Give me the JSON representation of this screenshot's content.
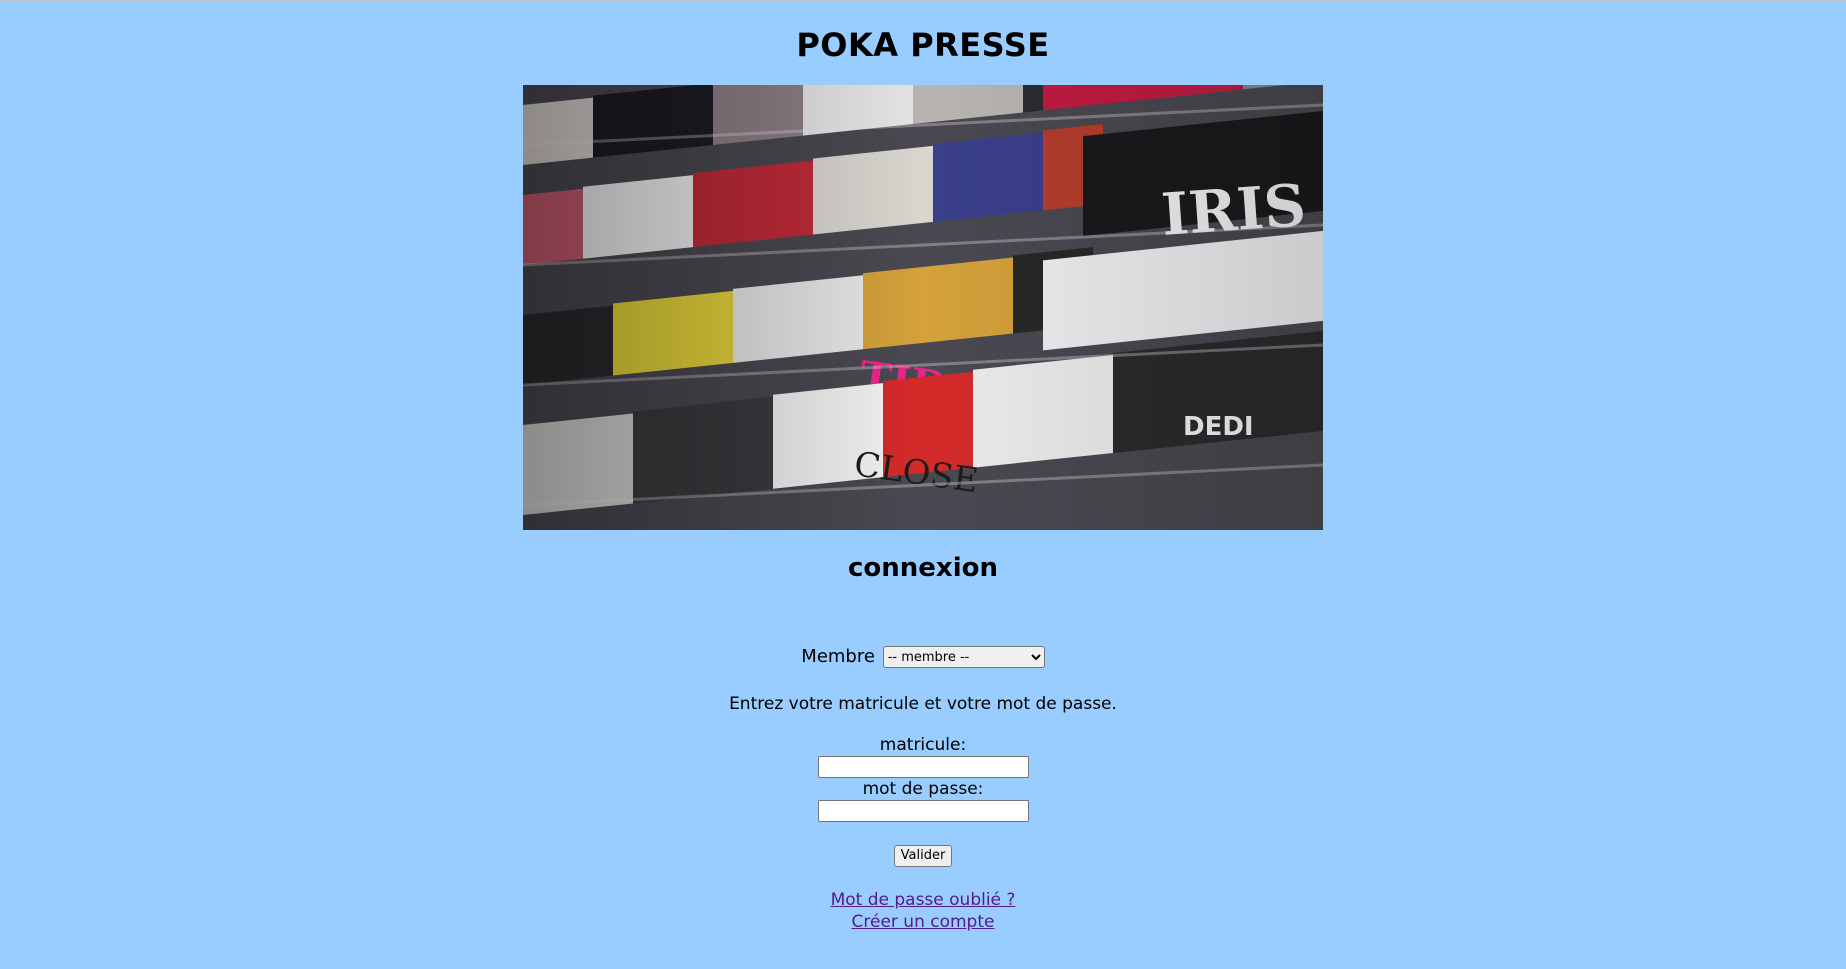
{
  "site": {
    "title": "POKA PRESSE"
  },
  "hero": {
    "image_alt": "Magazine rack"
  },
  "login": {
    "heading": "connexion",
    "member_label": "Membre",
    "member_select_value": "-- membre --",
    "instructions": "Entrez votre matricule et votre mot de passe.",
    "matricule_label": "matricule:",
    "matricule_value": "",
    "password_label": "mot de passe:",
    "password_value": "",
    "submit_label": "Valider"
  },
  "links": {
    "forgot_password": "Mot de passe oublié ?",
    "create_account": "Créer un compte"
  },
  "colors": {
    "background": "#99ccff",
    "link": "#551a8b"
  }
}
